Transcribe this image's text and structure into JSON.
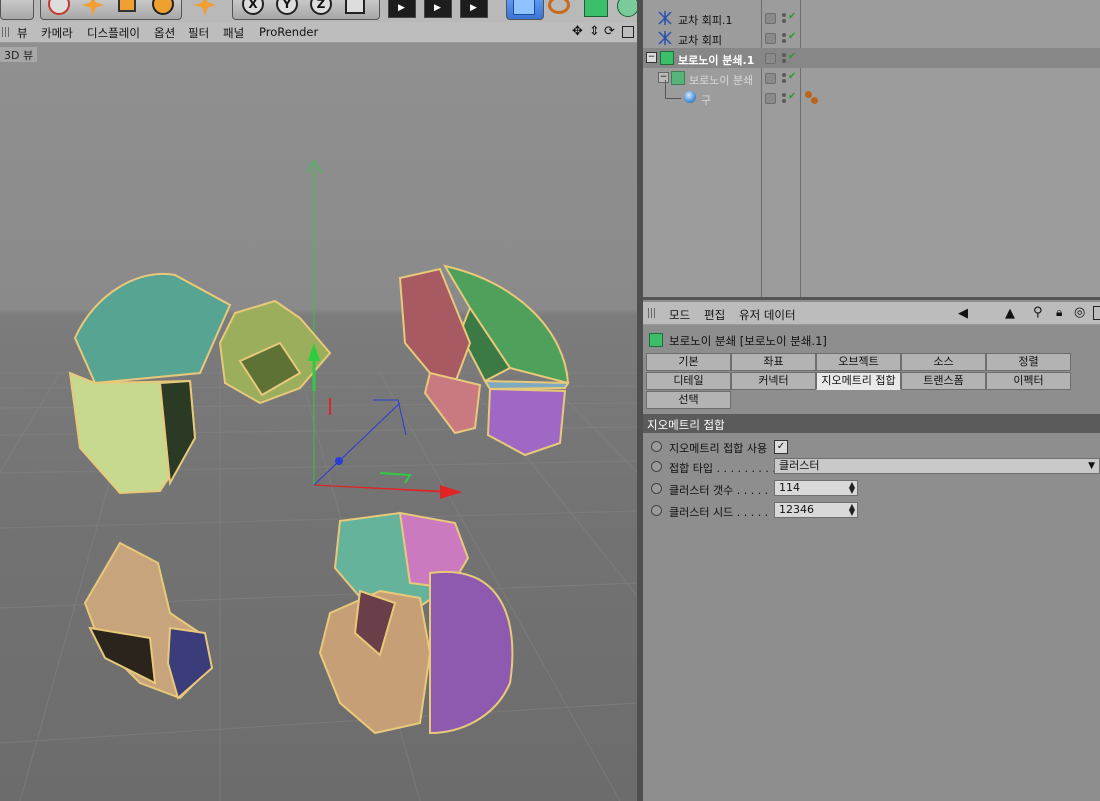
{
  "viewport": {
    "menu": [
      "뷰",
      "카메라",
      "디스플레이",
      "옵션",
      "필터",
      "패널",
      "ProRender"
    ],
    "label": "3D 뷰"
  },
  "toolbar": {
    "icons": [
      "live-selection-icon",
      "move-icon",
      "scale-icon",
      "rotate-icon",
      "move-icon",
      "x-axis-icon",
      "y-axis-icon",
      "z-axis-icon",
      "coordinate-system-icon",
      "render-view-icon",
      "render-picture-queue-icon",
      "render-settings-icon",
      "cube-primitive-icon",
      "spline-pen-icon",
      "subdivision-icon",
      "deformer-icon"
    ],
    "axis_labels": [
      "X",
      "Y",
      "Z"
    ]
  },
  "object_manager": {
    "objects": [
      {
        "name": "교차 회피.1",
        "icon": "cross-avoid-icon"
      },
      {
        "name": "교차 회피",
        "icon": "cross-avoid-icon"
      },
      {
        "name": "보로노이 분쇄.1",
        "icon": "voronoi-fracture-icon",
        "selected": true
      },
      {
        "name": "보로노이 분쇄",
        "icon": "voronoi-fracture-icon",
        "dim": true
      },
      {
        "name": "구",
        "icon": "sphere-icon",
        "dim": true
      }
    ]
  },
  "attribute_manager": {
    "menu": [
      "모드",
      "편집",
      "유저 데이터"
    ],
    "title": "보로노이 분쇄 [보로노이 분쇄.1]",
    "tabs_row1": [
      "기본",
      "좌표",
      "오브젝트",
      "소스",
      "정렬"
    ],
    "tabs_row2": [
      "디테일",
      "커넥터",
      "지오메트리 접합",
      "트랜스폼",
      "이펙터"
    ],
    "tabs_row3": [
      "선택"
    ],
    "active_tab": "지오메트리 접합",
    "section": "지오메트리 접합",
    "props": {
      "enable_label": "지오메트리 접합 사용",
      "enable_checked": true,
      "type_label": "접합 타입 . . . . . . . . .",
      "type_value": "클러스터",
      "count_label": "클러스터 갯수 . . . . .",
      "count_value": "114",
      "seed_label": "클러스터 시드 . . . . .",
      "seed_value": "12346"
    }
  },
  "colors": {
    "x_axis": "#e02424",
    "y_axis": "#2ecc40",
    "z_axis": "#2a3bd6",
    "selection_outline": "#e8c97a"
  }
}
